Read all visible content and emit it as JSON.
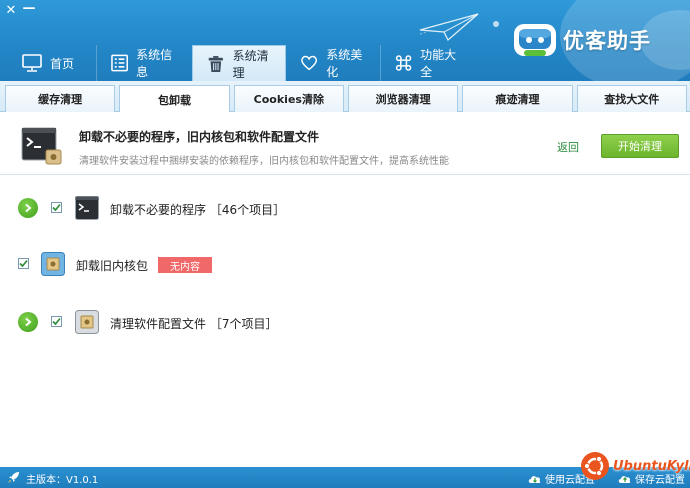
{
  "window": {
    "close_glyph": "✕",
    "minimize_glyph": "—"
  },
  "brand": {
    "name": "优客助手"
  },
  "main_tabs": [
    {
      "label": "首页",
      "icon": "monitor-icon"
    },
    {
      "label": "系统信息",
      "icon": "info-list-icon"
    },
    {
      "label": "系统清理",
      "icon": "trash-icon"
    },
    {
      "label": "系统美化",
      "icon": "heart-icon"
    },
    {
      "label": "功能大全",
      "icon": "command-icon"
    }
  ],
  "sub_tabs": [
    "缓存清理",
    "包卸载",
    "Cookies清除",
    "浏览器清理",
    "痕迹清理",
    "查找大文件"
  ],
  "info": {
    "title": "卸载不必要的程序，旧内核包和软件配置文件",
    "description": "清理软件安装过程中捆绑安装的依赖程序，旧内核包和软件配置文件，提高系统性能",
    "back": "返回",
    "start": "开始清理"
  },
  "items": [
    {
      "label": "卸载不必要的程序 ［46个项目］",
      "icon": "terminal-icon",
      "checked": true
    },
    {
      "label": "卸载旧内核包",
      "icon": "package-icon",
      "checked": true,
      "badge": "无内容"
    },
    {
      "label": "清理软件配置文件 ［7个项目］",
      "icon": "config-icon",
      "checked": true
    }
  ],
  "footer": {
    "version": "主版本：V1.0.1",
    "use_cloud": "使用云配置",
    "save_cloud": "保存云配置",
    "watermark": "UbuntuKylin"
  },
  "colors": {
    "header": "#2387c8",
    "start_button": "#6cb52d",
    "badge": "#f06868",
    "link": "#2a8a3a"
  }
}
